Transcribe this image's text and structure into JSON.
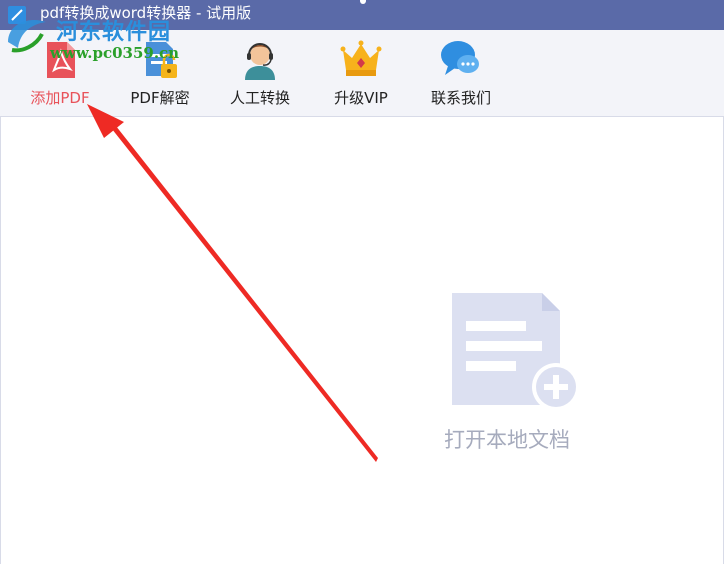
{
  "window": {
    "title": "pdf转换成word转换器 - 试用版"
  },
  "watermark": {
    "site_name": "河东软件园",
    "url": "www.pc0359.cn"
  },
  "toolbar": {
    "items": [
      {
        "label": "添加PDF",
        "icon": "pdf-file-icon",
        "active": true
      },
      {
        "label": "PDF解密",
        "icon": "unlock-file-icon",
        "active": false
      },
      {
        "label": "人工转换",
        "icon": "customer-service-icon",
        "active": false
      },
      {
        "label": "升级VIP",
        "icon": "crown-icon",
        "active": false
      },
      {
        "label": "联系我们",
        "icon": "chat-bubble-icon",
        "active": false
      }
    ]
  },
  "main": {
    "open_local_label": "打开本地文档",
    "open_local_icon": "add-document-icon"
  },
  "colors": {
    "titlebar": "#5a6aa8",
    "toolbar_bg": "#f3f4f9",
    "active_label": "#e8525a",
    "placeholder_icon": "#dce0f1",
    "placeholder_text": "#a6abbd",
    "annotation_arrow": "#ee2a24"
  }
}
